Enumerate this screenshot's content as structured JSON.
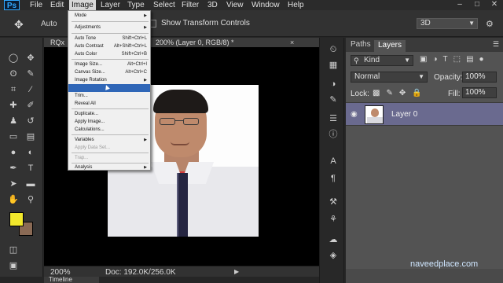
{
  "app": {
    "logo": "Ps"
  },
  "menubar": {
    "items": [
      "File",
      "Edit",
      "Image",
      "Layer",
      "Type",
      "Select",
      "Filter",
      "3D",
      "View",
      "Window",
      "Help"
    ],
    "window_buttons": [
      "–",
      "□",
      "✕"
    ]
  },
  "options": {
    "auto_label": "Auto",
    "show_transform_label": "Show Transform Controls",
    "mode_3d": "3D"
  },
  "document": {
    "tab_short": "RQx",
    "tab_title": "200% (Layer 0, RGB/8) *",
    "close": "×",
    "zoom": "200%",
    "doc_size": "Doc: 192.0K/256.0K",
    "timeline_tab": "Timeline"
  },
  "image_menu": {
    "items": [
      {
        "label": "Mode",
        "submenu": true
      },
      {
        "label": "Adjustments",
        "submenu": true
      },
      {
        "label": "Auto Tone",
        "shortcut": "Shift+Ctrl+L"
      },
      {
        "label": "Auto Contrast",
        "shortcut": "Alt+Shift+Ctrl+L"
      },
      {
        "label": "Auto Color",
        "shortcut": "Shift+Ctrl+B"
      },
      {
        "label": "Image Size...",
        "shortcut": "Alt+Ctrl+I"
      },
      {
        "label": "Canvas Size...",
        "shortcut": "Alt+Ctrl+C"
      },
      {
        "label": "Image Rotation",
        "submenu": true
      },
      {
        "label": "",
        "highlighted": true
      },
      {
        "label": "Trim..."
      },
      {
        "label": "Reveal All"
      },
      {
        "label": "Duplicate..."
      },
      {
        "label": "Apply Image..."
      },
      {
        "label": "Calculations..."
      },
      {
        "label": "Variables",
        "submenu": true
      },
      {
        "label": "Apply Data Set...",
        "disabled": true
      },
      {
        "label": "Trap...",
        "disabled": true
      },
      {
        "label": "Analysis",
        "submenu": true
      }
    ]
  },
  "layers_panel": {
    "tabs": [
      "Paths",
      "Layers"
    ],
    "kind": "Kind",
    "blend_mode": "Normal",
    "opacity_label": "Opacity:",
    "opacity_value": "100%",
    "lock_label": "Lock:",
    "fill_label": "Fill:",
    "fill_value": "100%",
    "layers": [
      {
        "name": "Layer 0",
        "visible": true
      }
    ]
  },
  "watermark": "naveedplace.com",
  "colors": {
    "foreground": "#f2e82c",
    "background": "#8a6a55",
    "selected_layer": "#6a6a8f",
    "menu_highlight": "#2f66b7"
  }
}
